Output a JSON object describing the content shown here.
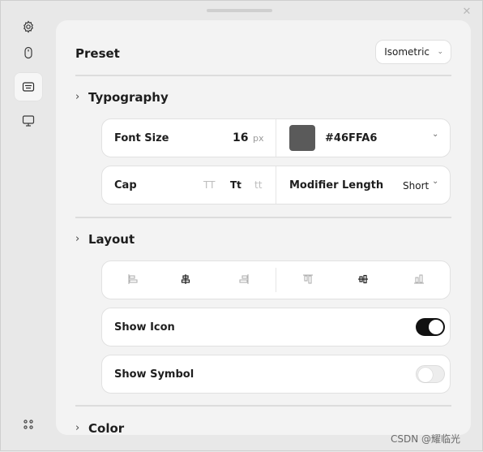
{
  "sidebar": {
    "items": [
      {
        "icon": "gear-icon"
      },
      {
        "icon": "mouse-icon"
      },
      {
        "icon": "keyboard-icon",
        "active": true
      },
      {
        "icon": "monitor-icon"
      }
    ],
    "bottom_icon": "apps-grid-icon"
  },
  "window": {
    "close_glyph": "✕"
  },
  "preset": {
    "title": "Preset",
    "value": "Isometric"
  },
  "typography": {
    "title": "Typography",
    "font_size_label": "Font Size",
    "font_size_value": "16",
    "font_size_unit": "px",
    "color_value": "#46FFA6",
    "swatch_color": "#5a5a5a",
    "cap_label": "Cap",
    "cap_options": [
      "TT",
      "Tt",
      "tt"
    ],
    "cap_selected": "Tt",
    "modifier_label": "Modifier Length",
    "modifier_value": "Short"
  },
  "layout": {
    "title": "Layout",
    "align_buttons": [
      "align-left-icon",
      "align-center-icon",
      "align-right-icon",
      "align-top-icon",
      "align-middle-icon",
      "align-bottom-icon"
    ],
    "selected": [
      "align-center-icon",
      "align-middle-icon"
    ],
    "show_icon_label": "Show Icon",
    "show_icon_on": true,
    "show_symbol_label": "Show Symbol",
    "show_symbol_on": false
  },
  "color": {
    "title": "Color"
  },
  "glyphs": {
    "caret_right": "›",
    "chevron_down": "⌄"
  },
  "watermark": "CSDN @耀临光"
}
